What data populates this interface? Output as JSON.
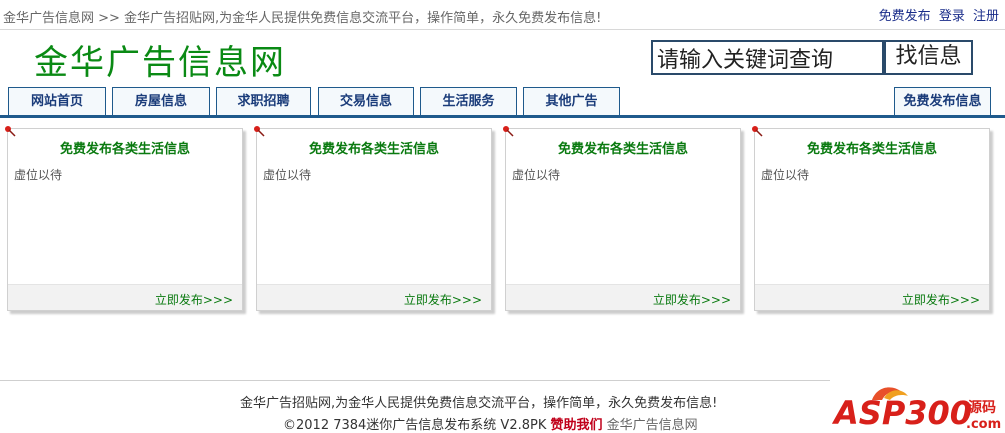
{
  "topbar": {
    "breadcrumb": "金华广告信息网 >> 金华广告招贴网,为金华人民提供免费信息交流平台，操作简单，永久免费发布信息!",
    "publish_link": "免费发布",
    "login_link": "登录",
    "register_link": "注册"
  },
  "header": {
    "logo": "金华广告信息网",
    "search_placeholder": "请输入关键词查询",
    "search_button": "找信息"
  },
  "nav": {
    "tabs": [
      "网站首页",
      "房屋信息",
      "求职招聘",
      "交易信息",
      "生活服务",
      "其他广告"
    ],
    "publish_tab": "免费发布信息"
  },
  "cards": [
    {
      "title": "免费发布各类生活信息",
      "body": "虚位以待",
      "link": "立即发布>>>"
    },
    {
      "title": "免费发布各类生活信息",
      "body": "虚位以待",
      "link": "立即发布>>>"
    },
    {
      "title": "免费发布各类生活信息",
      "body": "虚位以待",
      "link": "立即发布>>>"
    },
    {
      "title": "免费发布各类生活信息",
      "body": "虚位以待",
      "link": "立即发布>>>"
    }
  ],
  "footer": {
    "line1": "金华广告招贴网,为金华人民提供免费信息交流平台，操作简单，永久免费发布信息!",
    "copyright": "©2012 7384迷你广告信息发布系统 V2.8PK",
    "support_link": "赞助我们",
    "brand_link": "金华广告信息网"
  },
  "watermark": {
    "text": "ASP300",
    "sub": "源码",
    "sub2": ".com"
  },
  "colors": {
    "accent": "#1f5a8c",
    "logo_green": "#0a8a14",
    "link_green": "#0a7a10",
    "support_red": "#c0001a",
    "link_blue": "#1a2d8a"
  }
}
